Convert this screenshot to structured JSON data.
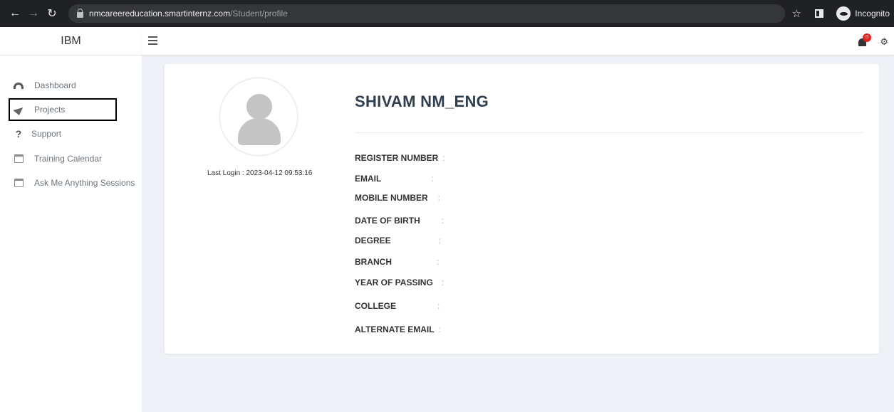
{
  "browser": {
    "url_host": "nmcareereducation.smartinternz.com",
    "url_path": "/Student/profile",
    "incognito_label": "Incognito",
    "icons": [
      "back-arrow-icon",
      "forward-arrow-icon",
      "reload-icon",
      "lock-icon",
      "star-icon",
      "side-panel-icon",
      "incognito-icon"
    ]
  },
  "brand": "IBM",
  "topbar": {
    "notification_count": "0",
    "icons": [
      "menu-icon",
      "bell-icon",
      "gear-icon"
    ]
  },
  "sidebar": {
    "items": [
      {
        "label": "Dashboard",
        "icon": "dashboard-icon"
      },
      {
        "label": "Projects",
        "icon": "paper-plane-icon",
        "active": true
      },
      {
        "label": "Support",
        "icon": "question-icon"
      },
      {
        "label": "Training Calendar",
        "icon": "calendar-icon"
      },
      {
        "label": "Ask Me Anything Sessions",
        "icon": "calendar-icon"
      }
    ]
  },
  "profile": {
    "name": "SHIVAM NM_ENG",
    "last_login": "Last Login : 2023-04-12 09:53:16",
    "separator": ":",
    "fields": [
      {
        "label": "REGISTER NUMBER",
        "value": ""
      },
      {
        "label": "EMAIL",
        "value": ""
      },
      {
        "label": "MOBILE NUMBER",
        "value": ""
      },
      {
        "label": "DATE OF BIRTH",
        "value": ""
      },
      {
        "label": "DEGREE",
        "value": ""
      },
      {
        "label": "BRANCH",
        "value": ""
      },
      {
        "label": "YEAR OF PASSING",
        "value": ""
      },
      {
        "label": "COLLEGE",
        "value": ""
      },
      {
        "label": "ALTERNATE EMAIL",
        "value": ""
      }
    ]
  },
  "colors": {
    "chrome": "#202124",
    "page_bg": "#eef1f6",
    "badge": "#e52222",
    "heading": "#2f3e4d"
  }
}
